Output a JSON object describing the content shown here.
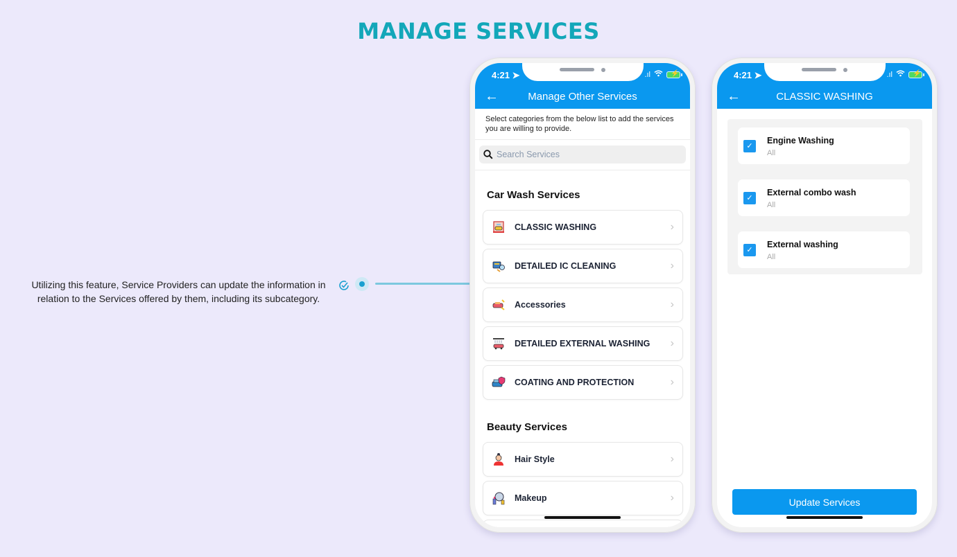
{
  "page": {
    "title": "MANAGE SERVICES",
    "annotation": "Utilizing this feature, Service Providers can update the information in relation to the Services offered by them, including its subcategory.",
    "colors": {
      "title": "#13a7b9",
      "primary": "#0a98ef",
      "background": "#ece9fb"
    }
  },
  "phone1": {
    "status": {
      "time": "4:21",
      "location_icon": "location-arrow-icon",
      "signal_icon": "signal-icon",
      "wifi_icon": "wifi-icon",
      "battery_icon": "battery-charging-icon"
    },
    "nav": {
      "back_icon": "arrow-left-icon",
      "title": "Manage Other Services"
    },
    "intro": "Select categories from the below list to add the services you are willing to provide.",
    "search": {
      "placeholder": "Search Services",
      "value": ""
    },
    "sections": [
      {
        "title": "Car Wash Services",
        "items": [
          {
            "label": "CLASSIC WASHING",
            "icon": "car-wash-icon"
          },
          {
            "label": "DETAILED IC CLEANING",
            "icon": "engine-cleaning-icon"
          },
          {
            "label": "Accessories",
            "icon": "car-accessories-icon"
          },
          {
            "label": "DETAILED EXTERNAL WASHING",
            "icon": "car-shower-icon"
          },
          {
            "label": "COATING AND PROTECTION",
            "icon": "car-shield-icon"
          }
        ]
      },
      {
        "title": "Beauty Services",
        "items": [
          {
            "label": "Hair Style",
            "icon": "hair-stylist-icon"
          },
          {
            "label": "Makeup",
            "icon": "makeup-mirror-icon"
          }
        ]
      }
    ]
  },
  "phone2": {
    "status": {
      "time": "4:21"
    },
    "nav": {
      "back_icon": "arrow-left-icon",
      "title": "CLASSIC WASHING"
    },
    "subservices": [
      {
        "name": "Engine Washing",
        "scope": "All",
        "checked": true
      },
      {
        "name": "External combo wash",
        "scope": "All",
        "checked": true
      },
      {
        "name": "External washing",
        "scope": "All",
        "checked": true
      }
    ],
    "update_button": "Update Services"
  }
}
